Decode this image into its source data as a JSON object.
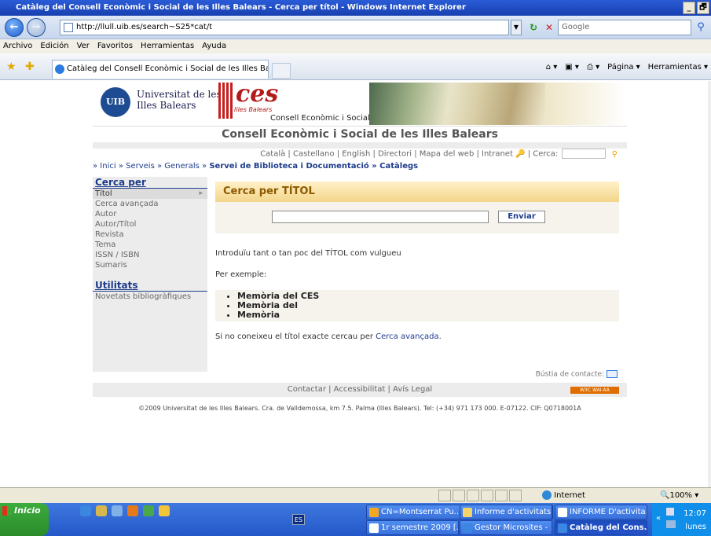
{
  "window": {
    "title": "Catàleg del Consell Econòmic i Social de les Illes Balears - Cerca per títol - Windows Internet Explorer",
    "minimize": "_",
    "maximize": "🗗"
  },
  "address_bar": {
    "url": "http://llull.uib.es/search~S25*cat/t",
    "search_placeholder": "Google"
  },
  "menu": [
    "Archivo",
    "Edición",
    "Ver",
    "Favoritos",
    "Herramientas",
    "Ayuda"
  ],
  "tab": {
    "label": "Catàleg del Consell Econòmic i Social de les Illes Balear..."
  },
  "command_bar": {
    "page": "Página",
    "tools": "Herramientas"
  },
  "site": {
    "uib_logo_text": "UIB",
    "uib_name_line1": "Universitat de les",
    "uib_name_line2": "Illes Balears",
    "ces_word": "ces",
    "ces_sub1": "Illes Balears",
    "ces_sub2": "Consell Econòmic i Social",
    "title": "Consell Econòmic i Social de les Illes Balears",
    "top_links": "Català | Castellano | English | Directori | Mapa del web | Intranet",
    "search_label": "| Cerca:",
    "breadcrumb": {
      "prefix": "» Inici » Serveis » Generals » ",
      "bold": "Servei de Biblioteca i Documentació » Catàlegs"
    },
    "sidebar": {
      "heading": "Cerca per",
      "items": [
        "Títol",
        "Cerca avançada",
        "Autor",
        "Autor/Títol",
        "Revista",
        "Tema",
        "ISSN / ISBN",
        "Sumaris"
      ],
      "heading2": "Utilitats",
      "items2": [
        "Novetats bibliogràfiques"
      ]
    },
    "panel": {
      "heading": "Cerca per TÍTOL",
      "input_value": "",
      "send_label": "Enviar",
      "intro": "Introduïu tant o tan poc del TÍTOL com vulgueu",
      "example_label": "Per exemple:",
      "examples": [
        "Memòria del CES",
        "Memòria del",
        "Memòria"
      ],
      "advanced_prefix": "Si no coneixeu el títol exacte cercau per ",
      "advanced_link": "Cerca avançada",
      "advanced_suffix": "."
    },
    "contact": "Bústia de contacte:",
    "footer_links": "Contactar | Accessibilitat | Avís Legal",
    "w3c": "W3C WAI-AA",
    "copyright": "©2009 Universitat de les Illes Balears. Cra. de Valldemossa, km 7.5. Palma (Illes Balears). Tel: (+34) 971 173 000. E-07122. CIF: Q0718001A"
  },
  "status_bar": {
    "zone": "Internet",
    "zoom": "100%"
  },
  "taskbar": {
    "start": "Inicio",
    "lang": "ES",
    "buttons": [
      "CN=Montserrat Pu...",
      "Informe d'activitats...",
      "INFORME D'activita...",
      "1r semestre 2009 [...",
      "Gestor Microsites - ...",
      "Catàleg del Cons..."
    ],
    "clock": "12:07",
    "day": "lunes"
  },
  "colors": {
    "link_blue": "#1e3c8c",
    "panel_orange": "#f3d58a",
    "brand_red": "#b31b1b"
  }
}
